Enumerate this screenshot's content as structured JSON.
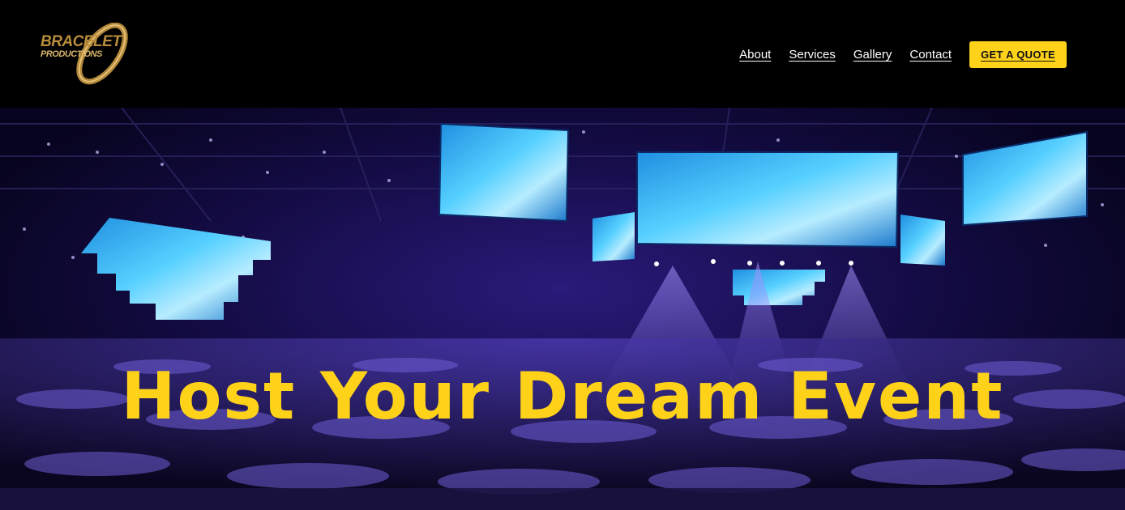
{
  "brand": {
    "logo_line1": "BRACELET",
    "logo_line2": "PRODUCTIONS"
  },
  "nav": {
    "items": [
      "About",
      "Services",
      "Gallery",
      "Contact"
    ],
    "cta_label": "GET A QUOTE"
  },
  "hero": {
    "headline": "Host Your Dream Event",
    "background_icon": "event-hall-image"
  },
  "colors": {
    "accent": "#ffd21a",
    "header_bg": "#000000",
    "hero_tint": "#2a1a7a",
    "screen_blue": "#2fb8ff"
  }
}
